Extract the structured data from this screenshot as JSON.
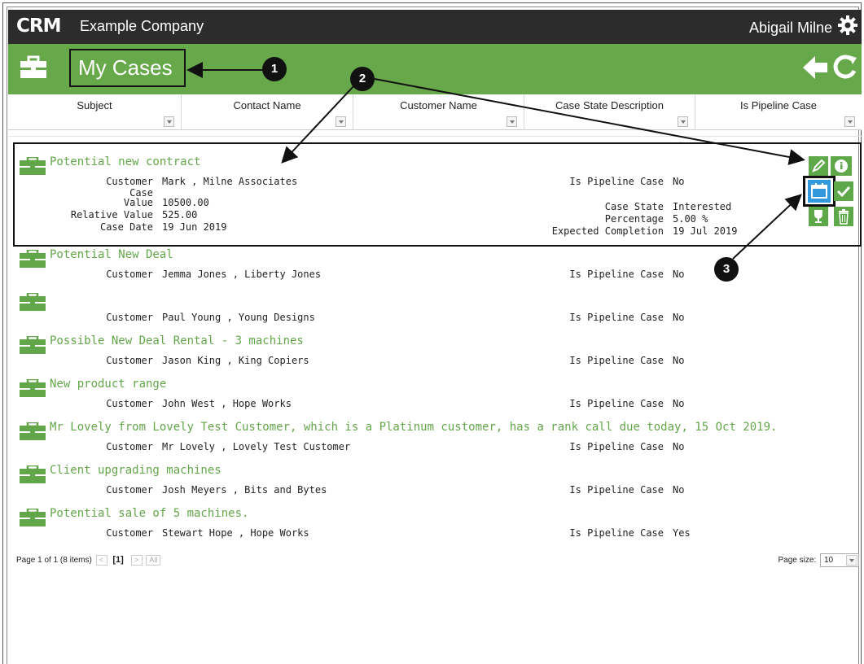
{
  "topbar": {
    "logo_text": "CRM",
    "company": "Example Company",
    "user_name": "Abigail Milne",
    "settings_icon": "gear-icon"
  },
  "header": {
    "title": "My Cases",
    "icons": [
      "briefcase-icon",
      "back-arrow-icon",
      "refresh-icon"
    ]
  },
  "columns": [
    "Subject",
    "Contact Name",
    "Customer Name",
    "Case State Description",
    "Is Pipeline Case"
  ],
  "field_labels": {
    "customer": "Customer",
    "case_value_1": "Case",
    "case_value_2": "Value",
    "relative_value": "Relative Value",
    "case_date": "Case Date",
    "is_pipeline": "Is Pipeline Case",
    "case_state": "Case State",
    "percentage": "Percentage",
    "expected_completion": "Expected Completion"
  },
  "selected_case": {
    "subject": "Potential new contract",
    "customer": "Mark , Milne Associates",
    "case_value": "10500.00",
    "relative_value": "525.00",
    "case_date": "19 Jun 2019",
    "is_pipeline": "No",
    "case_state": "Interested",
    "percentage": "5.00 %",
    "expected_completion": "19 Jul 2019"
  },
  "cases": [
    {
      "subject": "Potential New Deal",
      "customer": "Jemma Jones , Liberty Jones",
      "is_pipeline": "No"
    },
    {
      "subject": "",
      "customer": "Paul Young , Young Designs",
      "is_pipeline": "No"
    },
    {
      "subject": "Possible New Deal Rental - 3 machines",
      "customer": "Jason King , King Copiers",
      "is_pipeline": "No"
    },
    {
      "subject": "New product range",
      "customer": "John West , Hope Works",
      "is_pipeline": "No"
    },
    {
      "subject": "Mr Lovely from Lovely Test Customer, which is a Platinum customer, has a rank call due today, 15 Oct 2019.",
      "customer": "Mr Lovely , Lovely Test Customer",
      "is_pipeline": "No"
    },
    {
      "subject": "Client upgrading machines",
      "customer": "Josh Meyers , Bits and Bytes",
      "is_pipeline": "No"
    },
    {
      "subject": "Potential sale of 5 machines.",
      "customer": "Stewart Hope , Hope Works",
      "is_pipeline": "Yes"
    }
  ],
  "action_icons": [
    "edit-icon",
    "info-icon",
    "calendar-icon",
    "check-icon",
    "trophy-icon",
    "trash-icon"
  ],
  "callouts": [
    "1",
    "2",
    "3"
  ],
  "pager": {
    "summary": "Page 1 of 1 (8 items)",
    "prev": "<",
    "current": "[1]",
    "next": ">",
    "all": "All",
    "page_size_label": "Page size:",
    "page_size_value": "10"
  },
  "colors": {
    "accent_green": "#66a84a",
    "topbar": "#2c2c2c",
    "link_green": "#63a64a",
    "calendar_blue": "#3399dd"
  }
}
